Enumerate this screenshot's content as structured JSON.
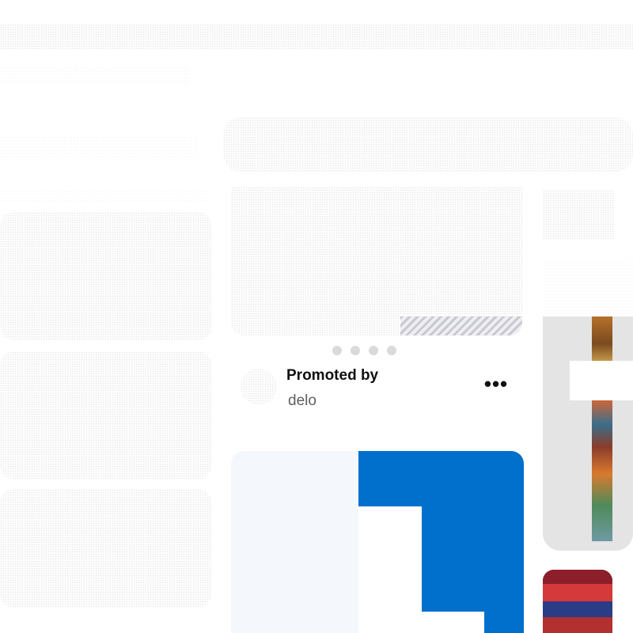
{
  "pin": {
    "promoted_label": "Promoted by",
    "advertiser": "delo",
    "more_label": "•••",
    "carousel_dot_count": 4
  },
  "colors": {
    "blue_pin": "#0070cc",
    "card_placeholder": "#e4e4e4",
    "dot": "#dadada",
    "secondary_text": "#5f5f5f"
  },
  "icons": {
    "more": "ellipsis-icon"
  }
}
